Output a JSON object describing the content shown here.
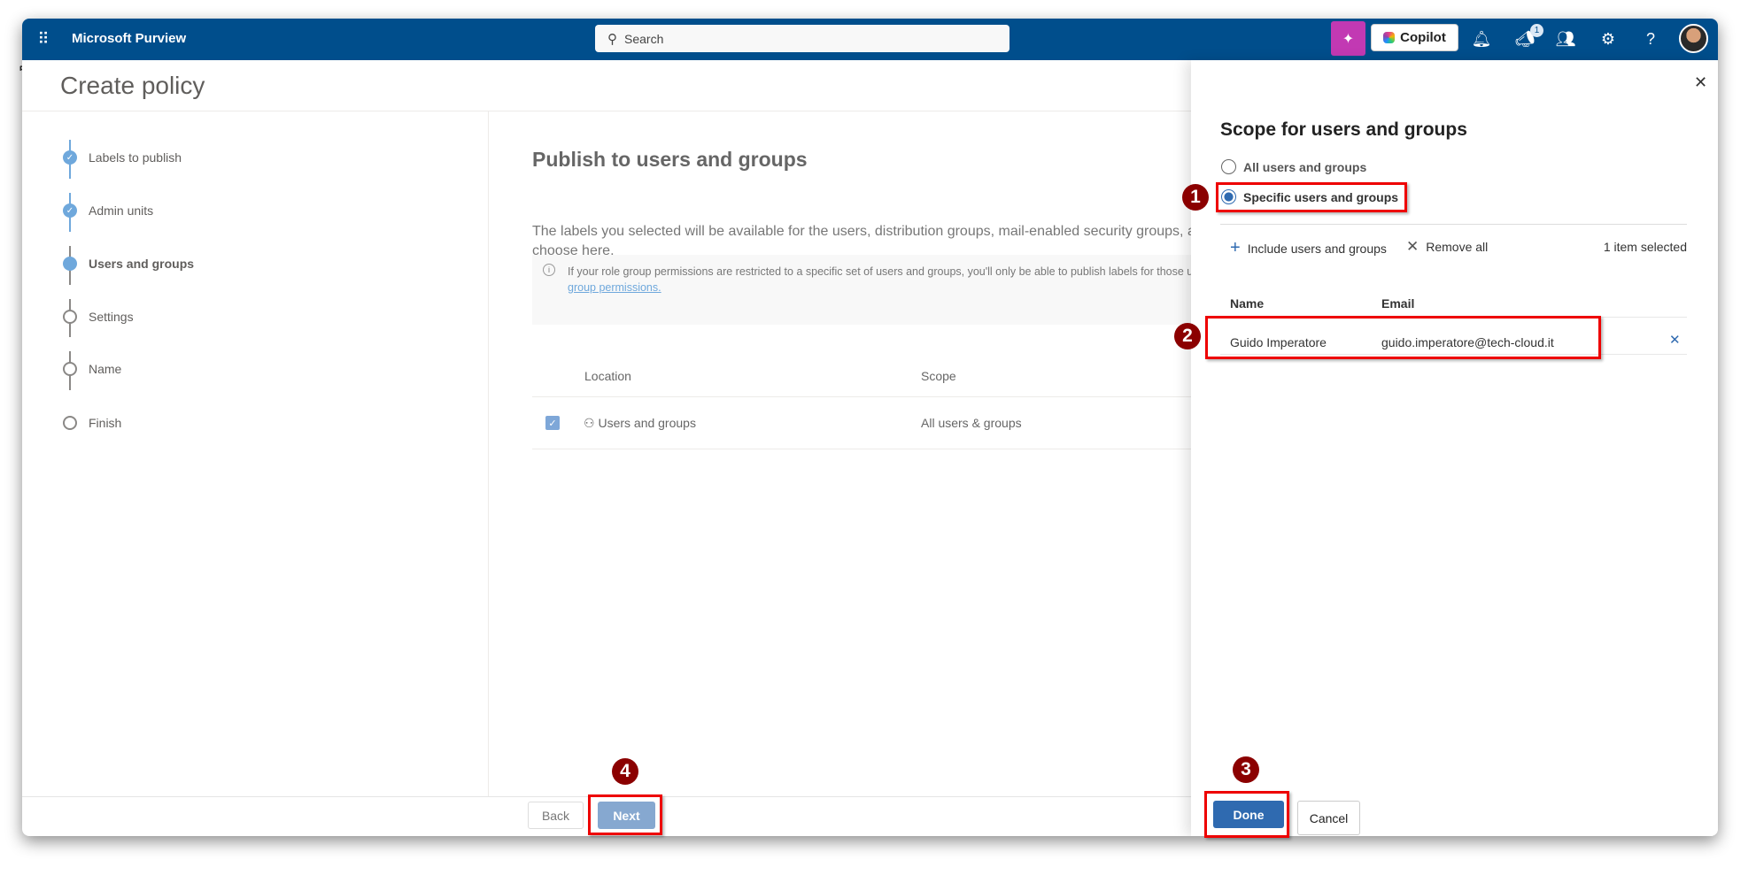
{
  "header": {
    "app_name": "Microsoft Purview",
    "search_placeholder": "Search",
    "copilot_label": "Copilot",
    "notification_count": "1",
    "help_label": "?"
  },
  "page": {
    "title": "Create policy"
  },
  "steps": [
    {
      "label": "Labels to publish",
      "state": "done"
    },
    {
      "label": "Admin units",
      "state": "done"
    },
    {
      "label": "Users and groups",
      "state": "current"
    },
    {
      "label": "Settings",
      "state": "todo"
    },
    {
      "label": "Name",
      "state": "todo"
    },
    {
      "label": "Finish",
      "state": "todo"
    }
  ],
  "main": {
    "heading": "Publish to users and groups",
    "description_line1": "The labels you selected will be available for the users, distribution groups, mail-enabled security groups, a",
    "description_line2": "choose here.",
    "info_text": "If your role group permissions are restricted to a specific set of users and groups, you'll only be able to publish labels for those users a",
    "info_link": "group permissions.",
    "table": {
      "headers": [
        "Location",
        "Scope"
      ],
      "rows": [
        {
          "location": "Users and groups",
          "scope": "All users & groups",
          "checked": true
        }
      ]
    },
    "back_label": "Back",
    "next_label": "Next"
  },
  "panel": {
    "title": "Scope for users and groups",
    "options": [
      {
        "label": "All users and groups",
        "selected": false
      },
      {
        "label": "Specific users and groups",
        "selected": true
      }
    ],
    "include_label": "Include users and groups",
    "remove_all_label": "Remove all",
    "selected_count": "1 item selected",
    "headers": {
      "name": "Name",
      "email": "Email"
    },
    "rows": [
      {
        "name": "Guido Imperatore",
        "email": "guido.imperatore@tech-cloud.it"
      }
    ],
    "done_label": "Done",
    "cancel_label": "Cancel"
  },
  "annotations": [
    "1",
    "2",
    "3",
    "4"
  ],
  "colors": {
    "header": "#004e8c",
    "accent": "#2f6ab0",
    "annotation": "#8b0000",
    "highlight": "#ee0000"
  }
}
